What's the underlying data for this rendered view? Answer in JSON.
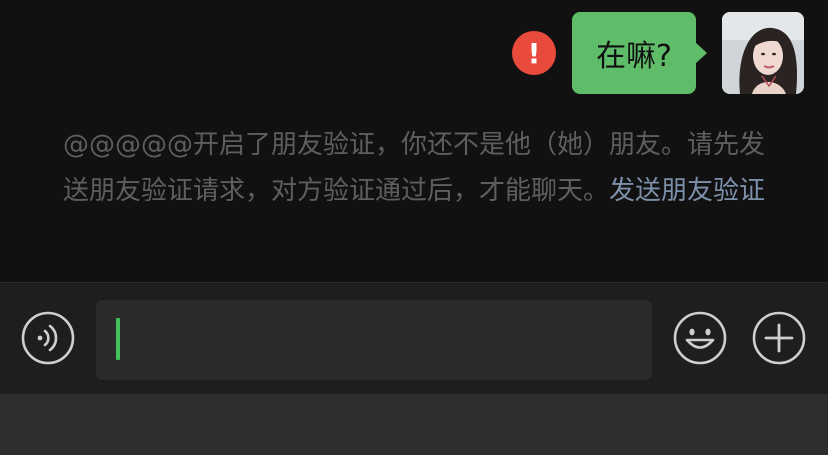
{
  "message": {
    "error_glyph": "!",
    "text": "在嘛?"
  },
  "system_note": {
    "text": "@@@@@开启了朋友验证，你还不是他（她）朋友。请先发送朋友验证请求，对方验证通过后，才能聊天。",
    "link": "发送朋友验证"
  },
  "input_bar": {
    "icons": [
      "voice-icon",
      "emoji-icon",
      "plus-icon"
    ],
    "input_value": ""
  },
  "colors": {
    "bubble": "#5fbd6a",
    "error": "#e84a3c",
    "link": "#7d90aa",
    "caret": "#45c15a"
  }
}
